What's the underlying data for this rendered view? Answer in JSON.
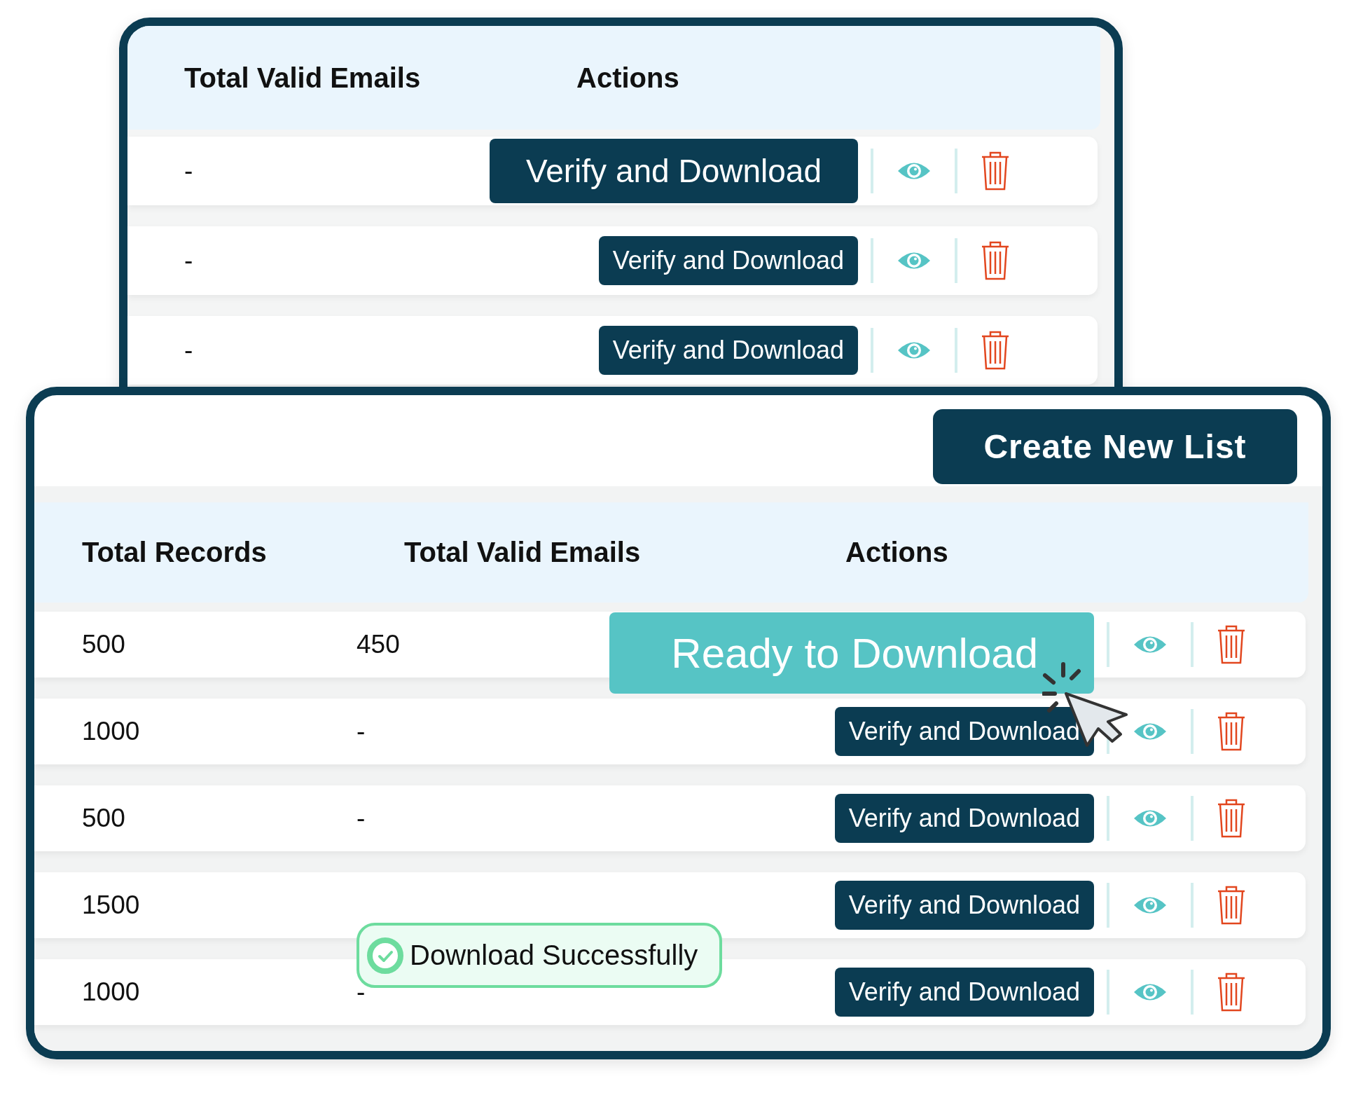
{
  "back_table": {
    "columns": [
      "Total Valid Emails",
      "Actions"
    ],
    "rows": [
      {
        "valid_emails": "-",
        "action": {
          "label": "Verify and Download",
          "kind": "large"
        }
      },
      {
        "valid_emails": "-",
        "action": {
          "label": "Verify and Download",
          "kind": "verify"
        }
      },
      {
        "valid_emails": "-",
        "action": {
          "label": "Verify and Download",
          "kind": "verify"
        }
      }
    ]
  },
  "front_panel": {
    "create_button": "Create New List",
    "table": {
      "columns": [
        "Total Records",
        "Total Valid Emails",
        "Actions"
      ],
      "rows": [
        {
          "records": "500",
          "valid_emails": "450",
          "action": {
            "label": "Ready to Download",
            "kind": "ready"
          }
        },
        {
          "records": "1000",
          "valid_emails": "-",
          "action": {
            "label": "Verify and Download",
            "kind": "verify"
          }
        },
        {
          "records": "500",
          "valid_emails": "-",
          "action": {
            "label": "Verify and Download",
            "kind": "verify"
          }
        },
        {
          "records": "1500",
          "action": {
            "label": "Verify and Download",
            "kind": "verify"
          }
        },
        {
          "records": "1000",
          "valid_emails": "-",
          "action": {
            "label": "Verify and Download",
            "kind": "verify"
          }
        }
      ]
    }
  },
  "toast": {
    "text": "Download Successfully"
  }
}
